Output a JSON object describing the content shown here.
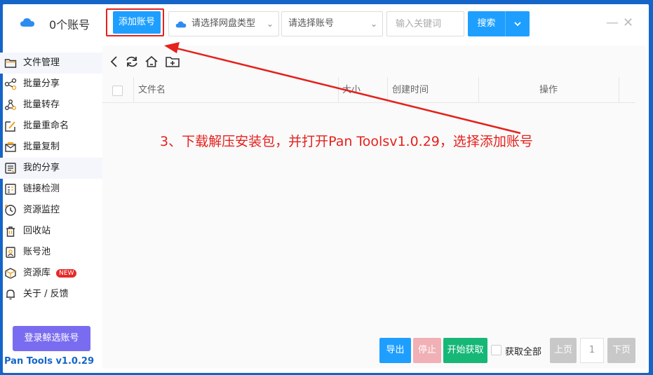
{
  "header": {
    "account_count": "0个账号",
    "add_account": "添加账号",
    "pan_type_placeholder": "请选择网盘类型",
    "account_placeholder": "请选择账号",
    "keyword_placeholder": "输入关键词",
    "search": "搜索"
  },
  "sidebar": {
    "items": [
      {
        "label": "文件管理",
        "icon": "folder-icon"
      },
      {
        "label": "批量分享",
        "icon": "share-icon"
      },
      {
        "label": "批量转存",
        "icon": "transfer-icon"
      },
      {
        "label": "批量重命名",
        "icon": "rename-icon"
      },
      {
        "label": "批量复制",
        "icon": "copy-icon"
      },
      {
        "label": "我的分享",
        "icon": "my-share-icon"
      },
      {
        "label": "链接检测",
        "icon": "link-check-icon"
      },
      {
        "label": "资源监控",
        "icon": "monitor-icon"
      },
      {
        "label": "回收站",
        "icon": "trash-icon"
      },
      {
        "label": "账号池",
        "icon": "account-pool-icon"
      },
      {
        "label": "资源库",
        "icon": "resource-icon",
        "badge": "NEW"
      },
      {
        "label": "关于 / 反馈",
        "icon": "bell-icon"
      }
    ],
    "login_button": "登录鲸选账号",
    "version": "Pan Tools v1.0.29"
  },
  "table": {
    "columns": [
      "文件名",
      "大小",
      "创建时间",
      "操作"
    ]
  },
  "annotation": "3、下载解压安装包，并打开Pan Toolsv1.0.29，选择添加账号",
  "footer": {
    "export": "导出",
    "stop": "停止",
    "start": "开始获取",
    "fetch_all": "获取全部",
    "prev": "上页",
    "page": "1",
    "next": "下页"
  },
  "colors": {
    "primary": "#1e9fff",
    "annotation_red": "#e5211c",
    "start_green": "#16b777",
    "login_purple": "#7a6cf0"
  }
}
